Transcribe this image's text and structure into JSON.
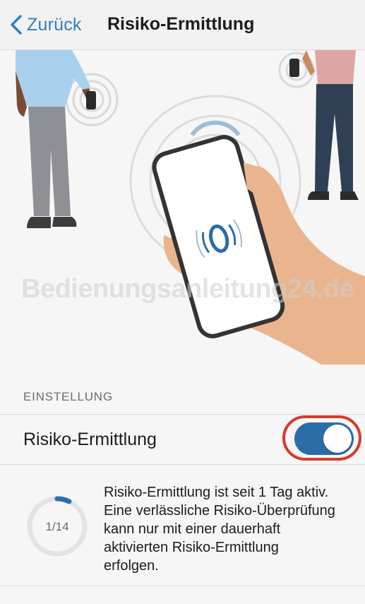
{
  "navbar": {
    "back_label": "Zurück",
    "title": "Risiko-Ermittlung"
  },
  "hero": {
    "watermark": "Bedienungsanleitung24.de"
  },
  "settings": {
    "section_label": "EINSTELLUNG",
    "row_label": "Risiko-Ermittlung",
    "toggle_on": true,
    "toggle_color": "#2d6da7",
    "highlight_color": "#d63a2b"
  },
  "status": {
    "progress_text": "1/14",
    "progress_fraction": 0.0714,
    "info_text": "Risiko-Ermittlung ist seit 1 Tag aktiv. Eine verlässliche Risiko-Überprüfung kann nur mit einer dauerhaft aktivierten Risiko-Ermittlung erfolgen."
  },
  "icons": {
    "back": "chevron-left-icon"
  }
}
